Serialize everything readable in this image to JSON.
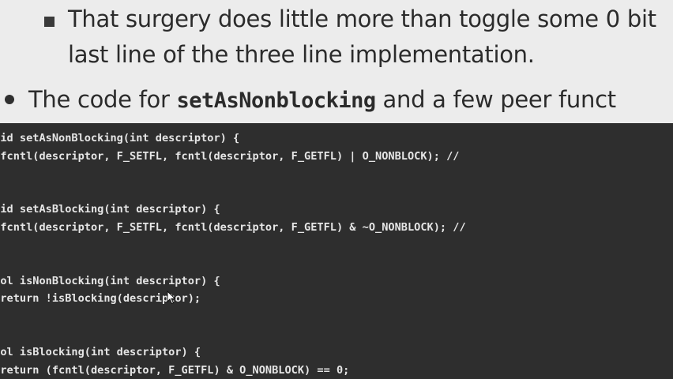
{
  "slide": {
    "sub_bullet_lines": [
      "That surgery does little more than toggle some 0 bit",
      "last line of the three line implementation."
    ],
    "main_bullet": {
      "prefix": "The code for ",
      "code": "setAsNonblocking",
      "suffix": " and a few peer funct"
    },
    "code_lines": [
      "void setAsNonBlocking(int descriptor) {",
      "  fcntl(descriptor, F_SETFL, fcntl(descriptor, F_GETFL) | O_NONBLOCK); //",
      "}",
      "",
      "void setAsBlocking(int descriptor) {",
      "  fcntl(descriptor, F_SETFL, fcntl(descriptor, F_GETFL) & ~O_NONBLOCK); //",
      "}",
      "",
      "bool isNonBlocking(int descriptor) {",
      "  return !isBlocking(descriptor);",
      "}",
      "",
      "bool isBlocking(int descriptor) {",
      "  return (fcntl(descriptor, F_GETFL) & O_NONBLOCK) == 0;"
    ]
  },
  "colors": {
    "page_background": "#ececec",
    "text": "#2b2b2b",
    "code_background": "#2e2e2e",
    "code_text": "#e6e6e6"
  },
  "icons": {
    "sub_bullet": "square-bullet-icon",
    "main_bullet": "round-bullet-icon",
    "pointer": "mouse-pointer-icon"
  }
}
